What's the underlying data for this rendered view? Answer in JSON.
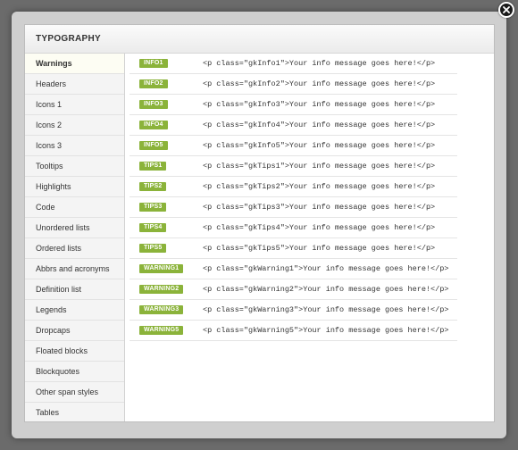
{
  "modal": {
    "title": "TYPOGRAPHY"
  },
  "sidebar": {
    "items": [
      {
        "label": "Warnings"
      },
      {
        "label": "Headers"
      },
      {
        "label": "Icons 1"
      },
      {
        "label": "Icons 2"
      },
      {
        "label": "Icons 3"
      },
      {
        "label": "Tooltips"
      },
      {
        "label": "Highlights"
      },
      {
        "label": "Code"
      },
      {
        "label": "Unordered lists"
      },
      {
        "label": "Ordered lists"
      },
      {
        "label": "Abbrs and acronyms"
      },
      {
        "label": "Definition list"
      },
      {
        "label": "Legends"
      },
      {
        "label": "Dropcaps"
      },
      {
        "label": "Floated blocks"
      },
      {
        "label": "Blockquotes"
      },
      {
        "label": "Other span styles"
      },
      {
        "label": "Tables"
      }
    ],
    "active_index": 0
  },
  "rows": [
    {
      "badge": "INFO1",
      "code": "<p class=\"gkInfo1\">Your info message goes here!</p>"
    },
    {
      "badge": "INFO2",
      "code": "<p class=\"gkInfo2\">Your info message goes here!</p>"
    },
    {
      "badge": "INFO3",
      "code": "<p class=\"gkInfo3\">Your info message goes here!</p>"
    },
    {
      "badge": "INFO4",
      "code": "<p class=\"gkInfo4\">Your info message goes here!</p>"
    },
    {
      "badge": "INFO5",
      "code": "<p class=\"gkInfo5\">Your info message goes here!</p>"
    },
    {
      "badge": "TIPS1",
      "code": "<p class=\"gkTips1\">Your info message goes here!</p>"
    },
    {
      "badge": "TIPS2",
      "code": "<p class=\"gkTips2\">Your info message goes here!</p>"
    },
    {
      "badge": "TIPS3",
      "code": "<p class=\"gkTips3\">Your info message goes here!</p>"
    },
    {
      "badge": "TIPS4",
      "code": "<p class=\"gkTips4\">Your info message goes here!</p>"
    },
    {
      "badge": "TIPS5",
      "code": "<p class=\"gkTips5\">Your info message goes here!</p>"
    },
    {
      "badge": "WARNING1",
      "code": "<p class=\"gkWarning1\">Your info message goes here!</p>"
    },
    {
      "badge": "WARNING2",
      "code": "<p class=\"gkWarning2\">Your info message goes here!</p>"
    },
    {
      "badge": "WARNING3",
      "code": "<p class=\"gkWarning3\">Your info message goes here!</p>"
    },
    {
      "badge": "WARNING5",
      "code": "<p class=\"gkWarning5\">Your info message goes here!</p>"
    }
  ],
  "colors": {
    "badge": "#8bb33a",
    "overlay": "#6b6b6b",
    "active_item_bg": "#fdfdf3"
  },
  "icons": {
    "close": "close-icon"
  }
}
